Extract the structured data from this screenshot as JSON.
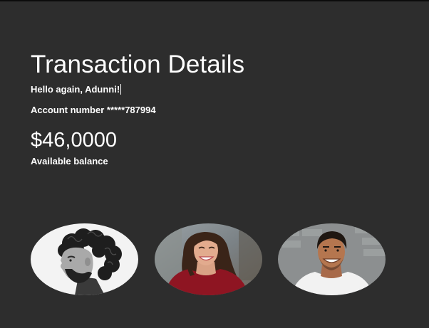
{
  "page": {
    "title": "Transaction Details",
    "greeting": "Hello again, Adunni!",
    "account_line": "Account number *****787994",
    "balance": "$46,0000",
    "balance_label": "Available balance"
  },
  "contacts": [
    {
      "icon": "curly-haired-man-photo"
    },
    {
      "icon": "smiling-woman-photo"
    },
    {
      "icon": "smiling-man-photo"
    }
  ]
}
